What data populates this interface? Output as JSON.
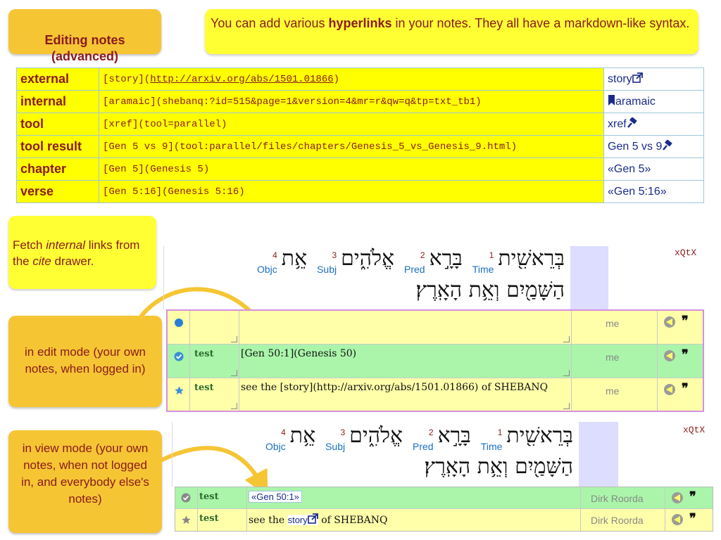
{
  "title": "Editing notes\n(advanced)",
  "intro": {
    "pre": "You can add various ",
    "bold": "hyperlinks",
    "post": " in your notes. They all have a markdown-like syntax."
  },
  "link_rows": [
    {
      "kind": "external",
      "code_pre": "[story](",
      "code_link": "http://arxiv.org/abs/1501.01866",
      "code_post": ")",
      "result": "story",
      "result_icon": "external-link-icon"
    },
    {
      "kind": "internal",
      "code_pre": "[aramaic](shebanq:?id=515&page=1&version=4&mr=r&qw=q&tp=txt_tb1)",
      "code_link": "",
      "code_post": "",
      "result": "aramaic",
      "result_icon": "bookmark-icon"
    },
    {
      "kind": "tool",
      "code_pre": "[xref](tool=parallel)",
      "code_link": "",
      "code_post": "",
      "result": "xref",
      "result_icon": "tool-icon"
    },
    {
      "kind": "tool result",
      "code_pre": "[Gen 5 vs 9](tool:parallel/files/chapters/Genesis_5_vs_Genesis_9.html)",
      "code_link": "",
      "code_post": "",
      "result": "Gen 5 vs 9",
      "result_icon": "tool-icon"
    },
    {
      "kind": "chapter",
      "code_pre": "[Gen 5](Genesis 5)",
      "code_link": "",
      "code_post": "",
      "result": "«Gen 5»",
      "result_icon": ""
    },
    {
      "kind": "verse",
      "code_pre": "[Gen 5:16](Genesis 5:16)",
      "code_link": "",
      "code_post": "",
      "result": "«Gen 5:16»",
      "result_icon": ""
    }
  ],
  "fetch_callout": {
    "t1": "Fetch ",
    "i1": "internal",
    "t2": " links from the ",
    "i2": "cite",
    "t3": " drawer."
  },
  "edit_callout": "in edit mode (your own notes, when logged in)",
  "view_callout": "in view mode (your own notes, when not logged in, and everybody else's notes)",
  "verse": {
    "words": [
      {
        "heb": "בְּרֵאשִׁ֖ית",
        "num": "1",
        "role": "Time"
      },
      {
        "heb": "בָּרָ֣א",
        "num": "2",
        "role": "Pred"
      },
      {
        "heb": "אֱלֹהִ֑ים",
        "num": "3",
        "role": "Subj"
      },
      {
        "heb": "אֵ֥ת",
        "num": "4",
        "role": "Objc"
      }
    ],
    "line2": "הַשָּׁמַ֖יִם וְאֵ֥ת הָאָֽרֶץ׃",
    "tag": "xQtX"
  },
  "edit_notes": [
    {
      "status_icon": "dot-icon",
      "keyword": "",
      "text": "",
      "user": "me",
      "color": "#ffffaa"
    },
    {
      "status_icon": "check-icon",
      "keyword": "test",
      "text": "[Gen 50:1](Genesis 50)",
      "user": "me",
      "color": "#aaf5aa"
    },
    {
      "status_icon": "star-icon",
      "keyword": "test",
      "text": "see the [story](http://arxiv.org/abs/1501.01866) of SHEBANQ",
      "user": "me",
      "color": "#ffffaa"
    }
  ],
  "view_notes": [
    {
      "status_icon": "check-icon",
      "keyword": "test",
      "link": "«Gen 50:1»",
      "pre": "",
      "post": "",
      "user": "Dirk Roorda",
      "color": "#aaf5aa"
    },
    {
      "status_icon": "star-icon",
      "keyword": "test",
      "link": "story",
      "pre": "see the ",
      "post": " of SHEBANQ",
      "user": "Dirk Roorda",
      "color": "#ffffaa"
    }
  ],
  "colors": {
    "callout": "#f5c534",
    "highlight": "#ffff00",
    "text_red": "#8b1a1a",
    "link_blue": "#1a2a8a"
  }
}
